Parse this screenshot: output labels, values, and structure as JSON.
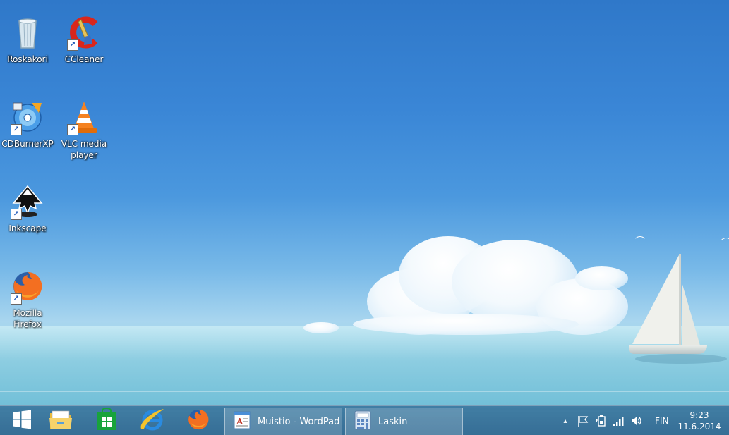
{
  "desktop": {
    "icons": [
      {
        "label": "Roskakori",
        "icon": "recycle-bin-icon"
      },
      {
        "label": "CCleaner",
        "icon": "ccleaner-icon"
      },
      {
        "label": "CDBurnerXP",
        "icon": "cdburnerxp-icon"
      },
      {
        "label": "VLC media player",
        "icon": "vlc-cone-icon"
      },
      {
        "label": "Inkscape",
        "icon": "inkscape-icon"
      },
      {
        "label": "Mozilla Firefox",
        "icon": "firefox-icon"
      }
    ]
  },
  "taskbar": {
    "pinned": [
      {
        "name": "start-button",
        "icon": "windows-logo-icon"
      },
      {
        "name": "file-explorer",
        "icon": "folder-icon"
      },
      {
        "name": "store",
        "icon": "store-bag-icon"
      },
      {
        "name": "internet-explorer",
        "icon": "ie-icon"
      },
      {
        "name": "firefox",
        "icon": "firefox-icon"
      }
    ],
    "windows": [
      {
        "label": "Muistio - WordPad",
        "icon": "wordpad-icon"
      },
      {
        "label": "Laskin",
        "icon": "calculator-icon"
      }
    ],
    "tray": {
      "overflow": "▴",
      "language": "FIN",
      "time": "9:23",
      "date": "11.6.2014"
    }
  },
  "colors": {
    "taskbar": "#3a7aa3",
    "sky_top": "#2f78c9",
    "sea": "#86c7dc"
  }
}
